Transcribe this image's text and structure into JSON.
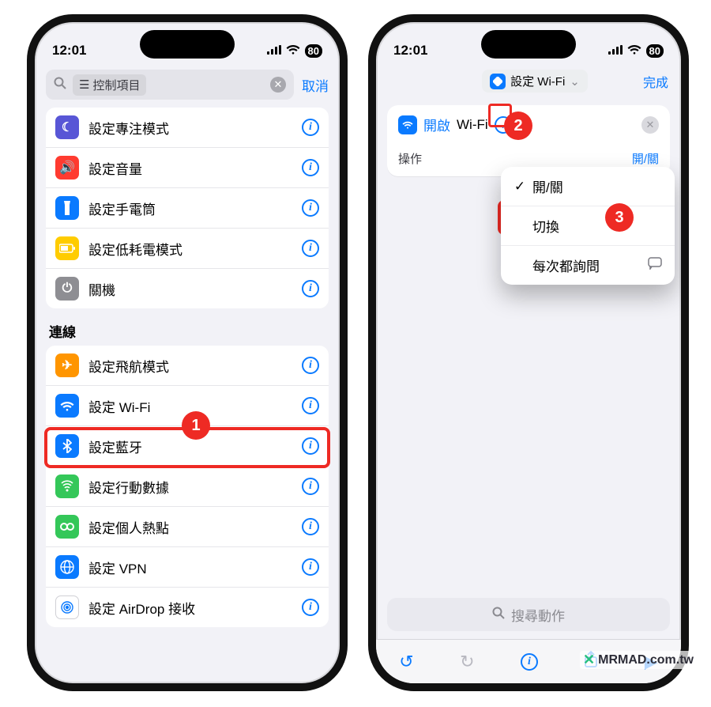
{
  "status": {
    "time": "12:01",
    "battery": "80"
  },
  "left": {
    "search": {
      "token": "控制項目",
      "cancel": "取消"
    },
    "group1": [
      {
        "label": "設定專注模式",
        "icon": "focus",
        "color": "#5856d6"
      },
      {
        "label": "設定音量",
        "icon": "volume",
        "color": "#ff3b30"
      },
      {
        "label": "設定手電筒",
        "icon": "torch",
        "color": "#0a7aff"
      },
      {
        "label": "設定低耗電模式",
        "icon": "lowpwr",
        "color": "#ffcc00"
      },
      {
        "label": "關機",
        "icon": "power",
        "color": "#8e8e93"
      }
    ],
    "section": "連線",
    "group2": [
      {
        "label": "設定飛航模式",
        "icon": "airplane",
        "color": "#ff9500"
      },
      {
        "label": "設定 Wi-Fi",
        "icon": "wifi",
        "color": "#0a7aff"
      },
      {
        "label": "設定藍牙",
        "icon": "bt",
        "color": "#0a7aff"
      },
      {
        "label": "設定行動數據",
        "icon": "cell",
        "color": "#34c759"
      },
      {
        "label": "設定個人熱點",
        "icon": "hotspot",
        "color": "#34c759"
      },
      {
        "label": "設定 VPN",
        "icon": "vpn",
        "color": "#0a7aff"
      },
      {
        "label": "設定 AirDrop 接收",
        "icon": "airdrop",
        "color": "#ffffff"
      }
    ]
  },
  "right": {
    "header": {
      "title": "設定 Wi-Fi",
      "done": "完成"
    },
    "card": {
      "prefix": "開啟",
      "subject": "Wi-Fi",
      "paramLabel": "操作",
      "paramValue": "開/關"
    },
    "menu": {
      "opt1": "開/關",
      "opt2": "切換",
      "opt3": "每次都詢問"
    },
    "searchActions": "搜尋動作"
  },
  "badges": {
    "b1": "1",
    "b2": "2",
    "b3": "3"
  },
  "watermark": "MRMAD.com.tw"
}
